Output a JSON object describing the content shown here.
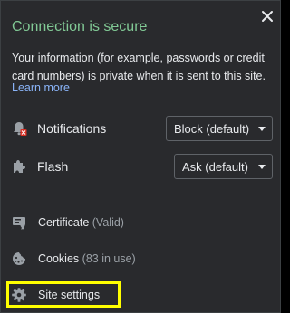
{
  "header": {
    "title": "Connection is secure",
    "description": "Your information (for example, passwords or credit card numbers) is private when it is sent to this site.",
    "learn_more": "Learn more"
  },
  "permissions": [
    {
      "label": "Notifications",
      "value": "Block (default)",
      "icon": "notifications-blocked-icon"
    },
    {
      "label": "Flash",
      "value": "Ask (default)",
      "icon": "puzzle-icon"
    }
  ],
  "links": [
    {
      "label": "Certificate",
      "detail": "(Valid)",
      "icon": "certificate-icon"
    },
    {
      "label": "Cookies",
      "detail": "(83 in use)",
      "icon": "cookie-icon"
    },
    {
      "label": "Site settings",
      "detail": "",
      "icon": "gear-icon"
    }
  ],
  "colors": {
    "background": "#292a2d",
    "secure_green": "#81c995",
    "link_blue": "#8ab4f8",
    "highlight": "#ffff00",
    "blocked_red": "#d93025"
  }
}
